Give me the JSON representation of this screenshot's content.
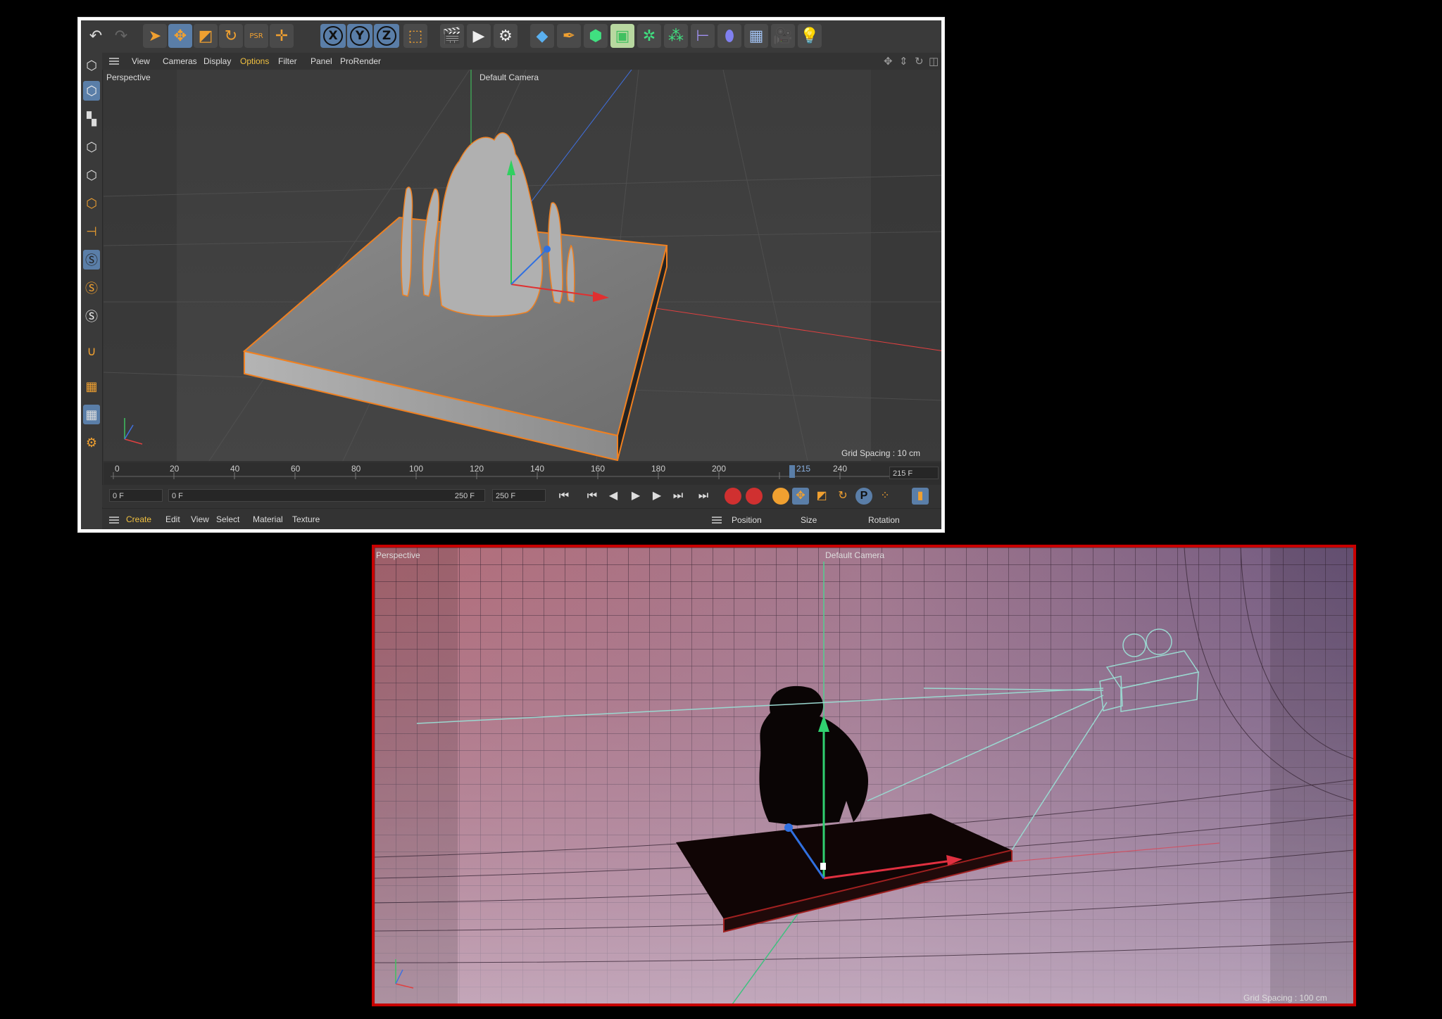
{
  "top": {
    "menu": [
      "View",
      "Cameras",
      "Display",
      "Options",
      "Filter",
      "Panel",
      "ProRender"
    ],
    "active_menu": "Options",
    "viewport_label": "Perspective",
    "camera_label": "Default Camera",
    "grid_spacing": "Grid Spacing : 10 cm",
    "axes": {
      "x": "X",
      "y": "Y",
      "z": "Z"
    },
    "timeline": {
      "ticks": [
        "0",
        "20",
        "40",
        "60",
        "80",
        "100",
        "120",
        "140",
        "160",
        "180",
        "200",
        "215",
        "240"
      ],
      "current_frame": "215 F"
    },
    "transport": {
      "start_field": "0 F",
      "range_start": "0 F",
      "range_end": "250 F",
      "end_field": "250 F"
    },
    "bottom_menu": [
      "Create",
      "Edit",
      "View",
      "Select",
      "Material",
      "Texture"
    ],
    "active_bottom_menu": "Create",
    "attribute_headers": [
      "Position",
      "Size",
      "Rotation"
    ],
    "toolbar_icons": [
      "undo-icon",
      "redo-icon",
      "select-icon",
      "move-icon",
      "scale-icon",
      "rotate-icon",
      "psr-icon",
      "transform-icon",
      "x-axis-lock",
      "y-axis-lock",
      "z-axis-lock",
      "coordinate-system-icon",
      "render-view-icon",
      "render-picture-viewer-icon",
      "render-settings-icon",
      "cube-icon",
      "pen-icon",
      "subdivision-icon",
      "extrude-icon",
      "generator-icon",
      "array-icon",
      "deformer-icon",
      "field-icon",
      "floor-icon",
      "camera-icon",
      "light-icon"
    ],
    "accent_color": "#f0a030",
    "select_highlight": "#5a7ea8"
  },
  "bottom": {
    "viewport_label": "Perspective",
    "camera_label": "Default Camera",
    "grid_spacing": "Grid Spacing : 100 cm",
    "frame_color": "#c80000"
  }
}
